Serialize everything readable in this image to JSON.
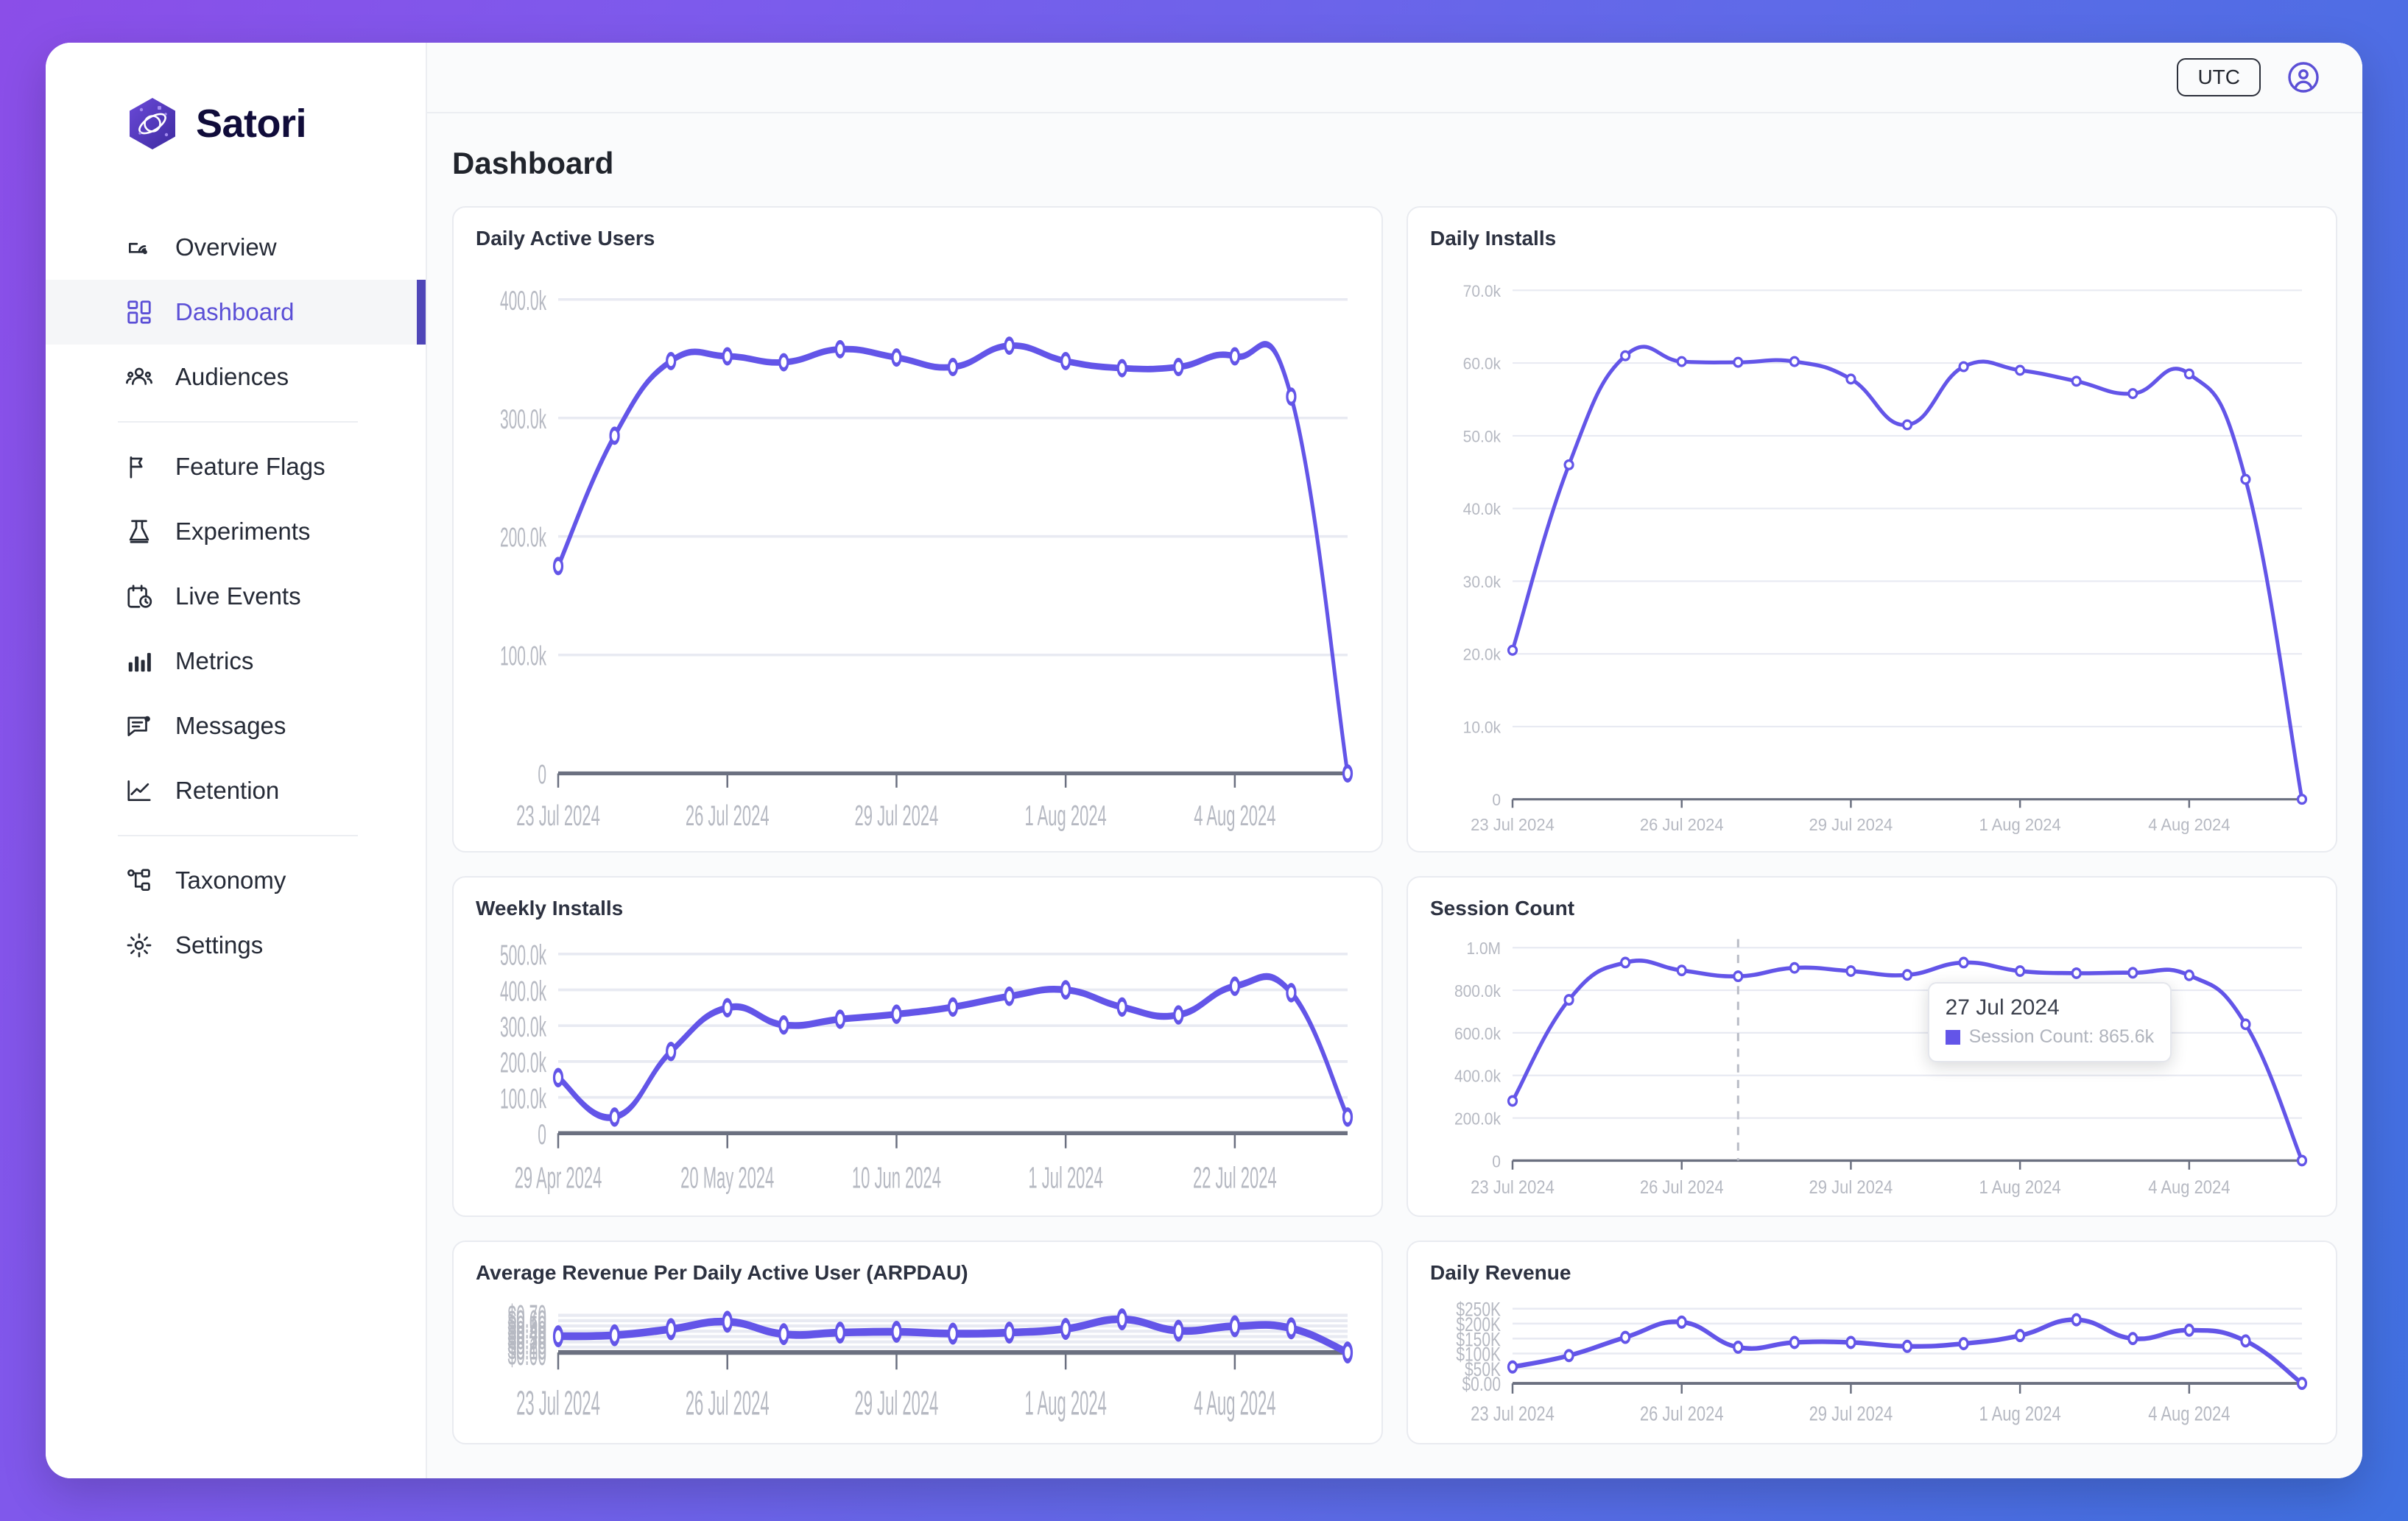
{
  "brand": {
    "name": "Satori",
    "logo_icon": "satori-hexagon-orbit-logo"
  },
  "sidebar": {
    "items": [
      {
        "label": "Overview",
        "icon": "cloud-signal-icon",
        "active": false
      },
      {
        "label": "Dashboard",
        "icon": "grid-squares-icon",
        "active": true
      },
      {
        "label": "Audiences",
        "icon": "people-group-icon",
        "active": false
      },
      {
        "label": "Feature Flags",
        "icon": "flag-icon",
        "active": false
      },
      {
        "label": "Experiments",
        "icon": "flask-icon",
        "active": false
      },
      {
        "label": "Live Events",
        "icon": "calendar-clock-icon",
        "active": false
      },
      {
        "label": "Metrics",
        "icon": "bar-chart-icon",
        "active": false
      },
      {
        "label": "Messages",
        "icon": "message-lines-icon",
        "active": false
      },
      {
        "label": "Retention",
        "icon": "line-chart-icon",
        "active": false
      },
      {
        "label": "Taxonomy",
        "icon": "hierarchy-icon",
        "active": false
      },
      {
        "label": "Settings",
        "icon": "gear-icon",
        "active": false
      }
    ]
  },
  "topbar": {
    "timezone_label": "UTC",
    "account_icon": "user-circle-icon"
  },
  "page": {
    "title": "Dashboard"
  },
  "tooltip": {
    "date": "27 Jul 2024",
    "series_label": "Session Count",
    "value": "865.6k",
    "text": "Session Count: 865.6k",
    "swatch_color": "#6355e8"
  },
  "theme": {
    "line_color": "#6355e8",
    "accent": "#4f46b8",
    "active_text": "#5b4fd6",
    "grid_color": "#e8eaf2",
    "axis_color": "#6b7080",
    "bg_gradient_from": "#8b4ee8",
    "bg_gradient_to": "#4070e0"
  },
  "chart_data": [
    {
      "id": "daily-active-users",
      "type": "line",
      "title": "Daily Active Users",
      "xlabel": "",
      "ylabel": "",
      "ylim": [
        0,
        420000
      ],
      "grid": true,
      "ytick_values": [
        0,
        100000,
        200000,
        300000,
        400000
      ],
      "ytick_labels": [
        "0",
        "100.0k",
        "200.0k",
        "300.0k",
        "400.0k"
      ],
      "xtick_labels": [
        "23 Jul 2024",
        "26 Jul 2024",
        "29 Jul 2024",
        "1 Aug 2024",
        "4 Aug 2024"
      ],
      "xtick_indices": [
        0,
        3,
        6,
        9,
        12
      ],
      "x": [
        "23 Jul 2024",
        "24 Jul 2024",
        "25 Jul 2024",
        "26 Jul 2024",
        "27 Jul 2024",
        "28 Jul 2024",
        "29 Jul 2024",
        "30 Jul 2024",
        "31 Jul 2024",
        "1 Aug 2024",
        "2 Aug 2024",
        "3 Aug 2024",
        "4 Aug 2024",
        "5 Aug 2024",
        "6 Aug 2024"
      ],
      "values": [
        175000,
        285000,
        348000,
        352000,
        347000,
        358000,
        351000,
        343000,
        361000,
        348000,
        342000,
        343000,
        352000,
        318000,
        0
      ]
    },
    {
      "id": "daily-installs",
      "type": "line",
      "title": "Daily Installs",
      "xlabel": "",
      "ylabel": "",
      "ylim": [
        0,
        73000
      ],
      "grid": true,
      "ytick_values": [
        0,
        10000,
        20000,
        30000,
        40000,
        50000,
        60000,
        70000
      ],
      "ytick_labels": [
        "0",
        "10.0k",
        "20.0k",
        "30.0k",
        "40.0k",
        "50.0k",
        "60.0k",
        "70.0k"
      ],
      "xtick_labels": [
        "23 Jul 2024",
        "26 Jul 2024",
        "29 Jul 2024",
        "1 Aug 2024",
        "4 Aug 2024"
      ],
      "xtick_indices": [
        0,
        3,
        6,
        9,
        12
      ],
      "x": [
        "23 Jul 2024",
        "24 Jul 2024",
        "25 Jul 2024",
        "26 Jul 2024",
        "27 Jul 2024",
        "28 Jul 2024",
        "29 Jul 2024",
        "30 Jul 2024",
        "31 Jul 2024",
        "1 Aug 2024",
        "2 Aug 2024",
        "3 Aug 2024",
        "4 Aug 2024",
        "5 Aug 2024",
        "6 Aug 2024"
      ],
      "values": [
        20500,
        46000,
        61000,
        60200,
        60100,
        60200,
        57800,
        51500,
        59500,
        59000,
        57500,
        55800,
        58500,
        44000,
        0
      ]
    },
    {
      "id": "weekly-installs",
      "type": "line",
      "title": "Weekly Installs",
      "xlabel": "",
      "ylabel": "",
      "ylim": [
        0,
        520000
      ],
      "grid": true,
      "ytick_values": [
        0,
        100000,
        200000,
        300000,
        400000,
        500000
      ],
      "ytick_labels": [
        "0",
        "100.0k",
        "200.0k",
        "300.0k",
        "400.0k",
        "500.0k"
      ],
      "xtick_labels": [
        "29 Apr 2024",
        "20 May 2024",
        "10 Jun 2024",
        "1 Jul 2024",
        "22 Jul 2024"
      ],
      "xtick_indices": [
        0,
        3,
        6,
        9,
        12
      ],
      "x": [
        "29 Apr 2024",
        "6 May 2024",
        "13 May 2024",
        "20 May 2024",
        "27 May 2024",
        "3 Jun 2024",
        "10 Jun 2024",
        "17 Jun 2024",
        "24 Jun 2024",
        "1 Jul 2024",
        "8 Jul 2024",
        "15 Jul 2024",
        "22 Jul 2024",
        "29 Jul 2024",
        "5 Aug 2024"
      ],
      "values": [
        155000,
        45000,
        228000,
        350000,
        302000,
        318000,
        332000,
        352000,
        382000,
        400000,
        352000,
        330000,
        410000,
        392000,
        45000
      ]
    },
    {
      "id": "session-count",
      "type": "line",
      "title": "Session Count",
      "xlabel": "",
      "ylabel": "",
      "ylim": [
        0,
        1040000
      ],
      "grid": true,
      "ytick_values": [
        0,
        200000,
        400000,
        600000,
        800000,
        1000000
      ],
      "ytick_labels": [
        "0",
        "200.0k",
        "400.0k",
        "600.0k",
        "800.0k",
        "1.0M"
      ],
      "xtick_labels": [
        "23 Jul 2024",
        "26 Jul 2024",
        "29 Jul 2024",
        "1 Aug 2024",
        "4 Aug 2024"
      ],
      "xtick_indices": [
        0,
        3,
        6,
        9,
        12
      ],
      "x": [
        "23 Jul 2024",
        "24 Jul 2024",
        "25 Jul 2024",
        "26 Jul 2024",
        "27 Jul 2024",
        "28 Jul 2024",
        "29 Jul 2024",
        "30 Jul 2024",
        "31 Jul 2024",
        "1 Aug 2024",
        "2 Aug 2024",
        "3 Aug 2024",
        "4 Aug 2024",
        "5 Aug 2024",
        "6 Aug 2024"
      ],
      "values": [
        280000,
        755000,
        930000,
        893000,
        865600,
        905000,
        890000,
        872000,
        930000,
        890000,
        880000,
        882000,
        870000,
        640000,
        0
      ],
      "highlight_index": 4,
      "annotation": {
        "date": "27 Jul 2024",
        "label": "Session Count",
        "value": "865.6k"
      }
    },
    {
      "id": "arpdau",
      "type": "line",
      "title": "Average Revenue Per Daily Active User (ARPDAU)",
      "xlabel": "",
      "ylabel": "",
      "ylim": [
        0,
        0.73
      ],
      "grid": true,
      "ytick_values": [
        0,
        0.1,
        0.2,
        0.3,
        0.4,
        0.5,
        0.6,
        0.7
      ],
      "ytick_labels": [
        "$0.00",
        "$0.10",
        "$0.20",
        "$0.30",
        "$0.40",
        "$0.50",
        "$0.60",
        "$0.70"
      ],
      "xtick_labels": [
        "23 Jul 2024",
        "26 Jul 2024",
        "29 Jul 2024",
        "1 Aug 2024",
        "4 Aug 2024"
      ],
      "xtick_indices": [
        0,
        3,
        6,
        9,
        12
      ],
      "x": [
        "23 Jul 2024",
        "24 Jul 2024",
        "25 Jul 2024",
        "26 Jul 2024",
        "27 Jul 2024",
        "28 Jul 2024",
        "29 Jul 2024",
        "30 Jul 2024",
        "31 Jul 2024",
        "1 Aug 2024",
        "2 Aug 2024",
        "3 Aug 2024",
        "4 Aug 2024",
        "5 Aug 2024",
        "6 Aug 2024"
      ],
      "values": [
        0.305,
        0.325,
        0.44,
        0.58,
        0.345,
        0.375,
        0.39,
        0.355,
        0.375,
        0.445,
        0.625,
        0.41,
        0.495,
        0.455,
        0.0
      ]
    },
    {
      "id": "daily-revenue",
      "type": "line",
      "title": "Daily Revenue",
      "xlabel": "",
      "ylabel": "",
      "ylim": [
        0,
        262000
      ],
      "grid": true,
      "ytick_values": [
        0,
        50000,
        100000,
        150000,
        200000,
        250000
      ],
      "ytick_labels": [
        "$0.00",
        "$50K",
        "$100K",
        "$150K",
        "$200K",
        "$250K"
      ],
      "xtick_labels": [
        "23 Jul 2024",
        "26 Jul 2024",
        "29 Jul 2024",
        "1 Aug 2024",
        "4 Aug 2024"
      ],
      "xtick_indices": [
        0,
        3,
        6,
        9,
        12
      ],
      "x": [
        "23 Jul 2024",
        "24 Jul 2024",
        "25 Jul 2024",
        "26 Jul 2024",
        "27 Jul 2024",
        "28 Jul 2024",
        "29 Jul 2024",
        "30 Jul 2024",
        "31 Jul 2024",
        "1 Aug 2024",
        "2 Aug 2024",
        "3 Aug 2024",
        "4 Aug 2024",
        "5 Aug 2024",
        "6 Aug 2024"
      ],
      "values": [
        55000,
        93000,
        154000,
        205000,
        121000,
        137000,
        137000,
        124000,
        133000,
        160000,
        213000,
        150000,
        178000,
        142000,
        0
      ]
    }
  ]
}
